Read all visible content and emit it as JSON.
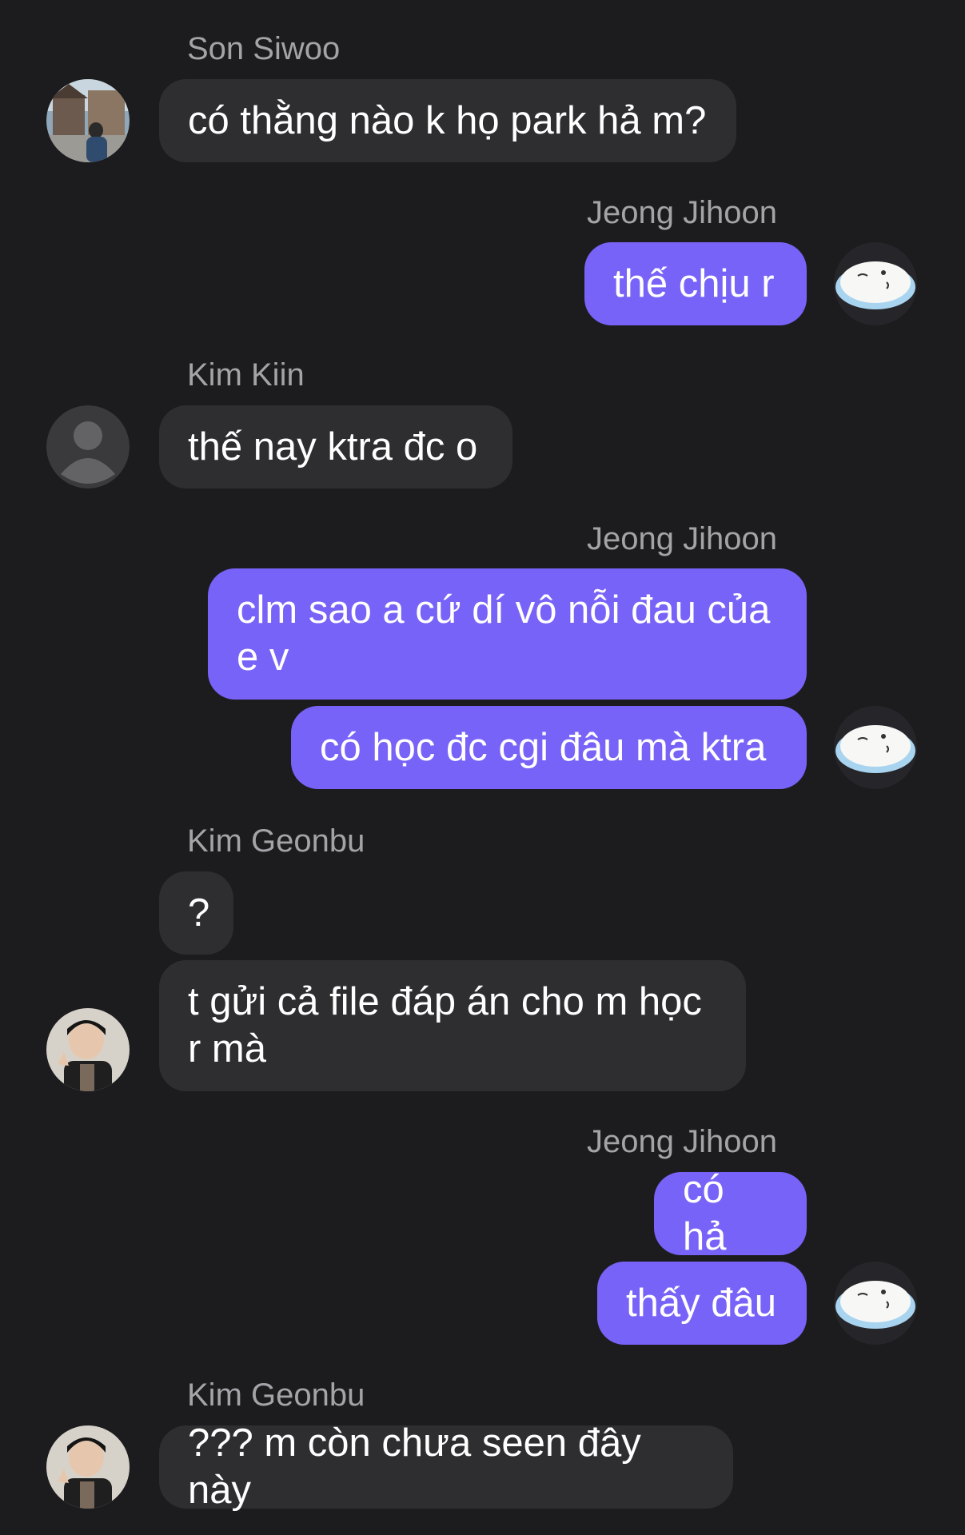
{
  "messages": [
    {
      "sender": "Son Siwoo",
      "side": "in",
      "text": "có thằng nào k họ park hả m?"
    },
    {
      "sender": "Jeong Jihoon",
      "side": "out",
      "text": "thế chịu r"
    },
    {
      "sender": "Kim Kiin",
      "side": "in",
      "text": "thế nay ktra đc o"
    },
    {
      "sender": "Jeong Jihoon",
      "side": "out",
      "text": "clm sao a cứ dí vô nỗi đau của e v"
    },
    {
      "sender": "Jeong Jihoon",
      "side": "out",
      "text": "có học đc cgi đâu mà ktra"
    },
    {
      "sender": "Kim Geonbu",
      "side": "in",
      "text": "?"
    },
    {
      "sender": "Kim Geonbu",
      "side": "in",
      "text": "t gửi cả file đáp án cho m học r mà"
    },
    {
      "sender": "Jeong Jihoon",
      "side": "out",
      "text": "có hả"
    },
    {
      "sender": "Jeong Jihoon",
      "side": "out",
      "text": "thấy đâu"
    },
    {
      "sender": "Kim Geonbu",
      "side": "in",
      "text": "??? m còn chưa seen đây này"
    }
  ],
  "colors": {
    "background": "#1c1c1e",
    "incoming_bubble": "#2e2e31",
    "outgoing_bubble": "#7863f8",
    "sender_name": "#a3a3a8",
    "text": "#ffffff"
  },
  "avatars": {
    "son_siwoo": "photo-street-avatar",
    "jeong_jihoon": "rice-cake-sticker-avatar",
    "kim_kiin": "default-person-avatar",
    "kim_geonbu": "photo-person-avatar"
  }
}
